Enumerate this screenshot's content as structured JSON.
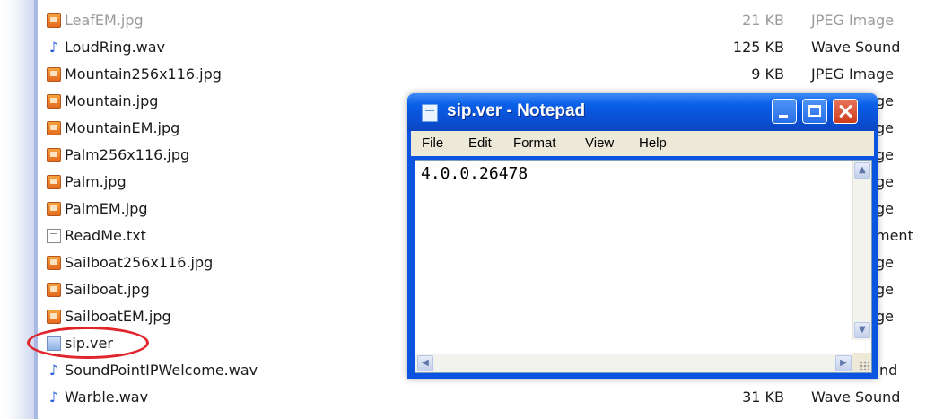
{
  "files": [
    {
      "name": "LeafEM.jpg",
      "size": "21 KB",
      "type": "JPEG Image",
      "icon": "jpeg-file-icon",
      "faded": true
    },
    {
      "name": "LoudRing.wav",
      "size": "125 KB",
      "type": "Wave Sound",
      "icon": "wave-file-icon"
    },
    {
      "name": "Mountain256x116.jpg",
      "size": "9 KB",
      "type": "JPEG Image",
      "icon": "jpeg-file-icon"
    },
    {
      "name": "Mountain.jpg",
      "size": "",
      "type": "ge",
      "icon": "jpeg-file-icon"
    },
    {
      "name": "MountainEM.jpg",
      "size": "",
      "type": "ge",
      "icon": "jpeg-file-icon"
    },
    {
      "name": "Palm256x116.jpg",
      "size": "",
      "type": "ge",
      "icon": "jpeg-file-icon"
    },
    {
      "name": "Palm.jpg",
      "size": "",
      "type": "ge",
      "icon": "jpeg-file-icon"
    },
    {
      "name": "PalmEM.jpg",
      "size": "",
      "type": "ge",
      "icon": "jpeg-file-icon"
    },
    {
      "name": "ReadMe.txt",
      "size": "",
      "type": "ment",
      "icon": "text-file-icon"
    },
    {
      "name": "Sailboat256x116.jpg",
      "size": "",
      "type": "ge",
      "icon": "jpeg-file-icon"
    },
    {
      "name": "Sailboat.jpg",
      "size": "",
      "type": "ge",
      "icon": "jpeg-file-icon"
    },
    {
      "name": "SailboatEM.jpg",
      "size": "",
      "type": "ge",
      "icon": "jpeg-file-icon"
    },
    {
      "name": "sip.ver",
      "size": "",
      "type": "",
      "icon": "ver-file-icon",
      "highlighted": true
    },
    {
      "name": "SoundPointIPWelcome.wav",
      "size": "",
      "type": "nd",
      "icon": "wave-file-icon"
    },
    {
      "name": "Warble.wav",
      "size": "31 KB",
      "type": "Wave Sound",
      "icon": "wave-file-icon"
    }
  ],
  "notepad": {
    "title": "sip.ver - Notepad",
    "menu": [
      "File",
      "Edit",
      "Format",
      "View",
      "Help"
    ],
    "content": "4.0.0.26478"
  },
  "colors": {
    "highlight_circle": "#e0242a",
    "titlebar": "#0a5fe8",
    "close_button": "#cf3d1c"
  }
}
